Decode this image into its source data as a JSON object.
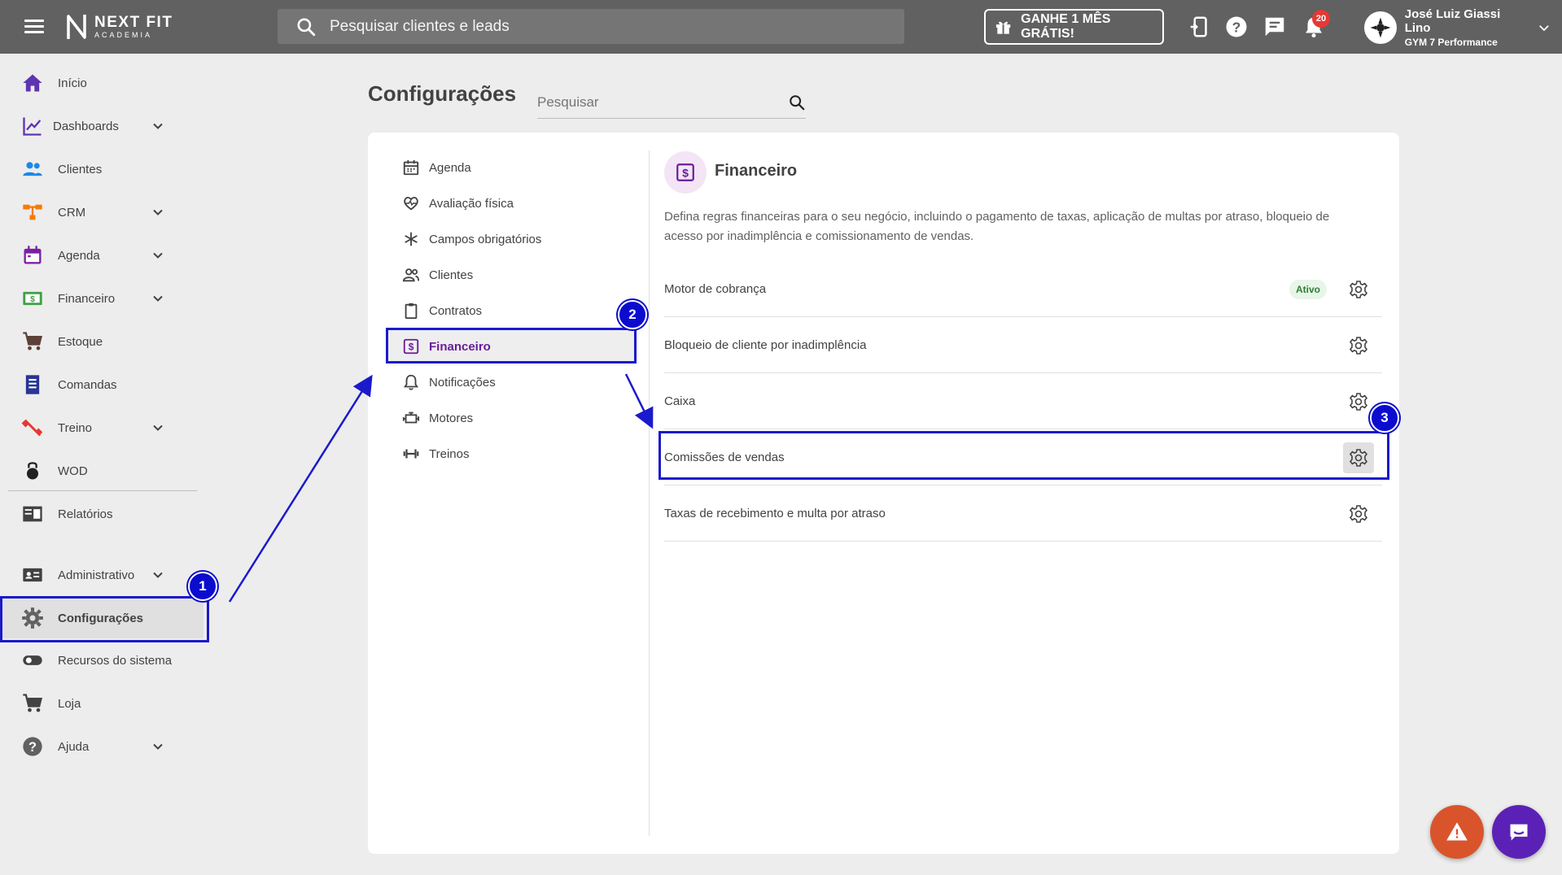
{
  "topbar": {
    "logo_main": "NEXT FIT",
    "logo_sub": "ACADEMIA",
    "search_placeholder": "Pesquisar clientes e leads",
    "promo_label": "GANHE 1 MÊS GRÁTIS!",
    "notification_count": "20",
    "user_name": "José Luiz Giassi Lino",
    "user_gym": "GYM 7 Performance"
  },
  "sidebar": {
    "items": [
      {
        "label": "Início"
      },
      {
        "label": "Dashboards"
      },
      {
        "label": "Clientes"
      },
      {
        "label": "CRM"
      },
      {
        "label": "Agenda"
      },
      {
        "label": "Financeiro"
      },
      {
        "label": "Estoque"
      },
      {
        "label": "Comandas"
      },
      {
        "label": "Treino"
      },
      {
        "label": "WOD"
      },
      {
        "label": "Relatórios"
      },
      {
        "label": "Administrativo"
      },
      {
        "label": "Configurações"
      },
      {
        "label": "Recursos do sistema"
      },
      {
        "label": "Loja"
      },
      {
        "label": "Ajuda"
      }
    ]
  },
  "page": {
    "title": "Configurações",
    "search_placeholder": "Pesquisar"
  },
  "config_menu": {
    "items": [
      {
        "label": "Agenda"
      },
      {
        "label": "Avaliação física"
      },
      {
        "label": "Campos obrigatórios"
      },
      {
        "label": "Clientes"
      },
      {
        "label": "Contratos"
      },
      {
        "label": "Financeiro"
      },
      {
        "label": "Notificações"
      },
      {
        "label": "Motores"
      },
      {
        "label": "Treinos"
      }
    ]
  },
  "section": {
    "title": "Financeiro",
    "description": "Defina regras financeiras para o seu negócio, incluindo o pagamento de taxas, aplicação de multas por atraso, bloqueio de acesso por inadimplência e comissionamento de vendas.",
    "rows": [
      {
        "label": "Motor de cobrança",
        "badge": "Ativo"
      },
      {
        "label": "Bloqueio de cliente por inadimplência"
      },
      {
        "label": "Caixa"
      },
      {
        "label": "Comissões de vendas"
      },
      {
        "label": "Taxas de recebimento e multa por atraso"
      }
    ]
  },
  "annotations": {
    "step1": "1",
    "step2": "2",
    "step3": "3"
  },
  "colors": {
    "topbar": "#616161",
    "accent_purple": "#6a1b9a",
    "annotation_blue": "#1a1acc",
    "badge_red": "#e53935"
  }
}
